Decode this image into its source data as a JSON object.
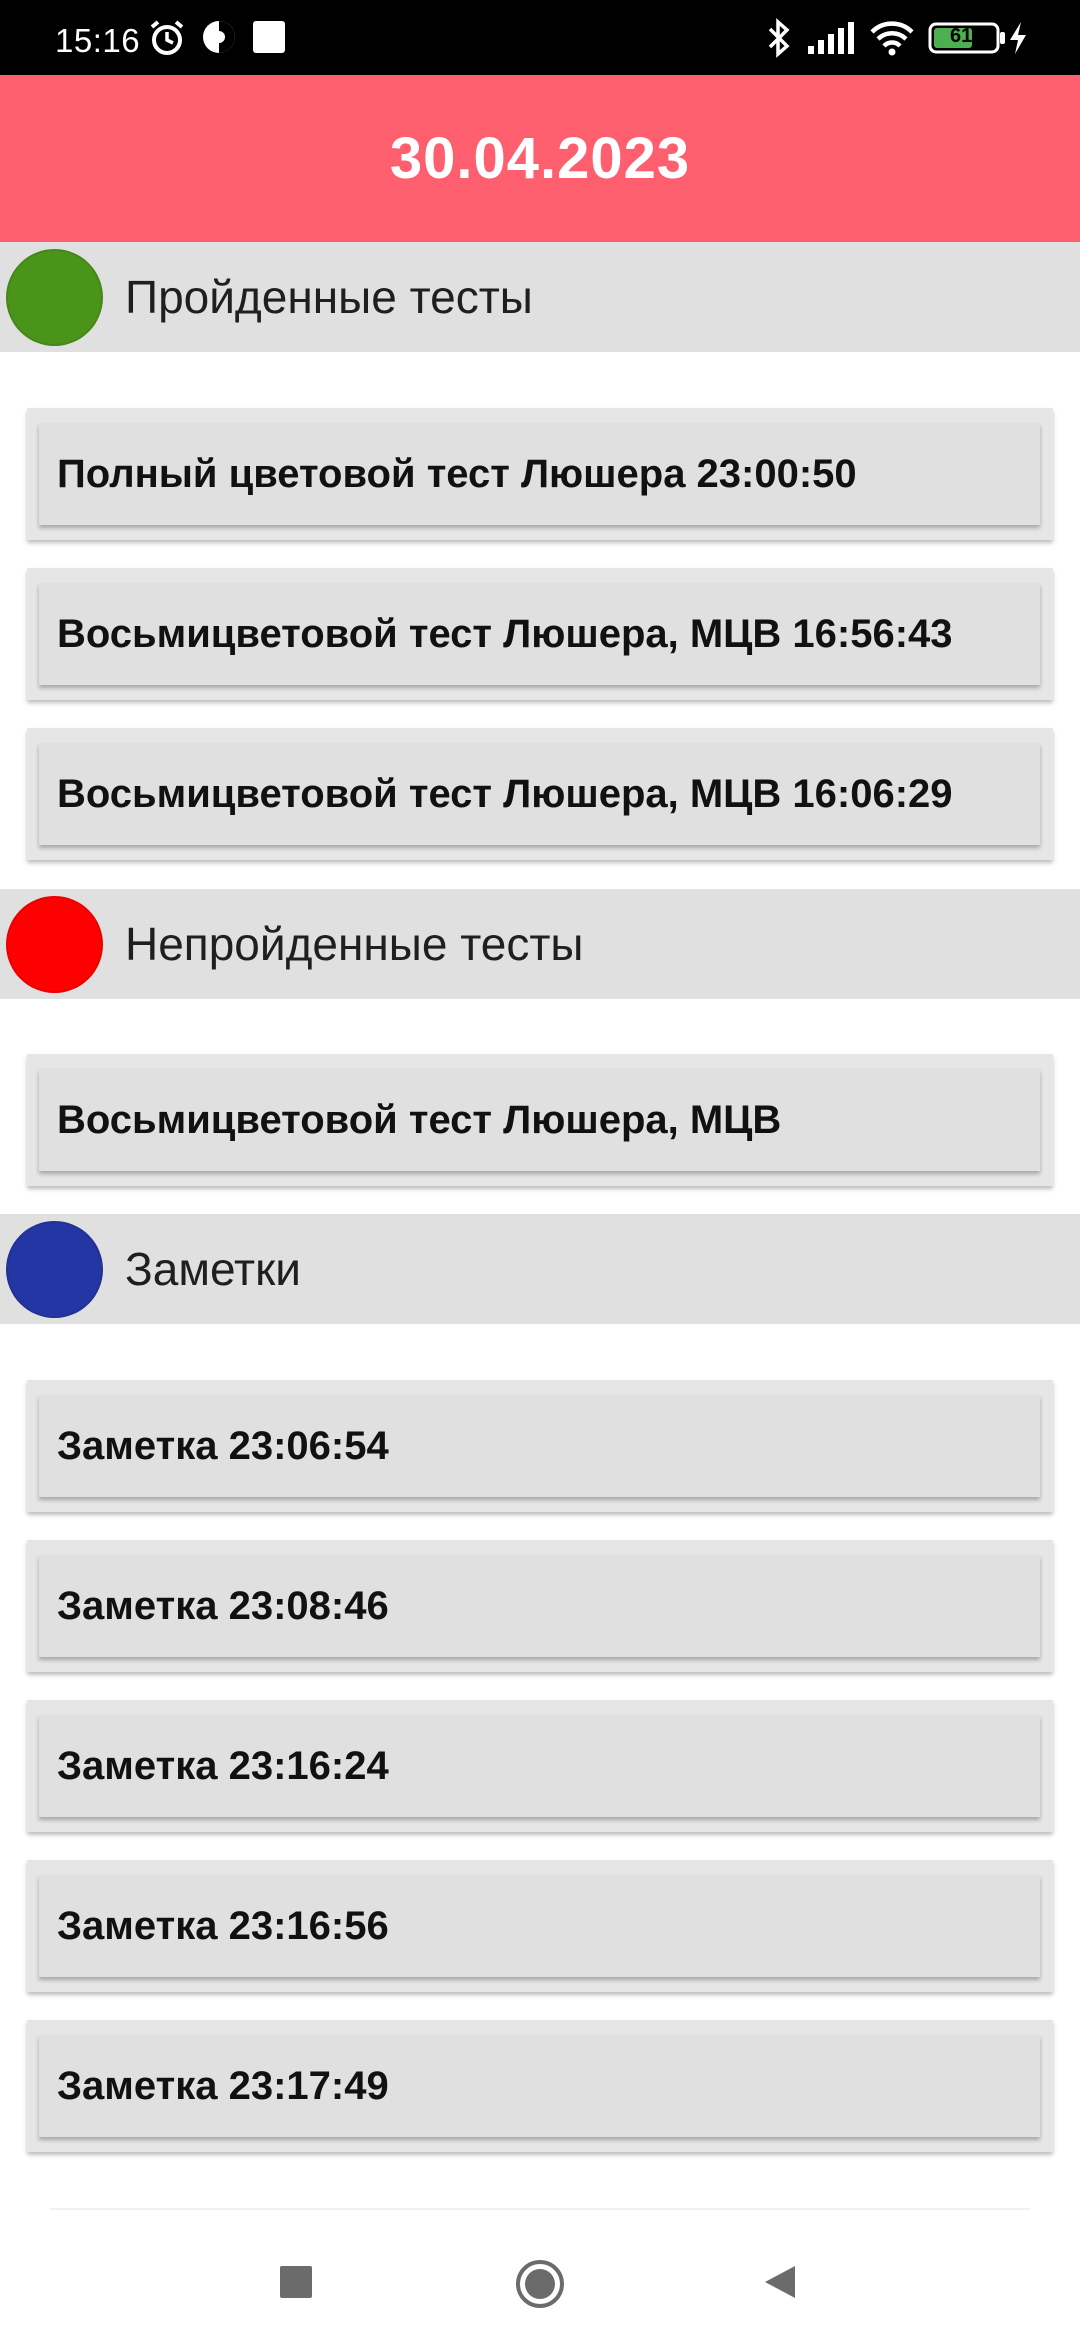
{
  "status_bar": {
    "time": "15:16",
    "battery_level": "61",
    "icons": [
      "alarm-icon",
      "data-saver-icon",
      "notification-square-icon",
      "bluetooth-icon",
      "signal-icon",
      "wifi-icon",
      "battery-icon",
      "charging-icon"
    ]
  },
  "header": {
    "title": "30.04.2023",
    "background": "#fe5f6f"
  },
  "sections": {
    "passed": {
      "title": "Пройденные тесты",
      "dot_color": "#4a9419",
      "items": [
        "Полный цветовой тест Люшера 23:00:50",
        "Восьмицветовой тест Люшера, МЦВ 16:56:43",
        "Восьмицветовой тест Люшера, МЦВ 16:06:29"
      ]
    },
    "failed": {
      "title": "Непройденные тесты",
      "dot_color": "#ff0000",
      "items": [
        "Восьмицветовой тест Люшера, МЦВ"
      ]
    },
    "notes": {
      "title": "Заметки",
      "dot_color": "#2436a3",
      "items": [
        "Заметка 23:06:54",
        "Заметка 23:08:46",
        "Заметка 23:16:24",
        "Заметка 23:16:56",
        "Заметка 23:17:49"
      ]
    }
  },
  "nav_bar": {
    "buttons": [
      "recents-square-icon",
      "home-circle-icon",
      "back-triangle-icon"
    ]
  }
}
